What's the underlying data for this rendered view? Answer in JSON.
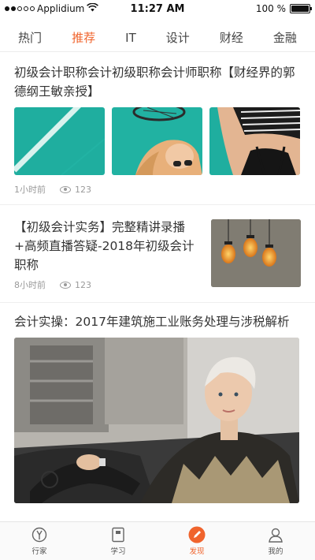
{
  "status_bar": {
    "carrier": "Applidium",
    "time": "11:27 AM",
    "battery": "100 %",
    "battery_level": 1.0
  },
  "tabs": [
    {
      "label": "热门",
      "active": false
    },
    {
      "label": "推荐",
      "active": true
    },
    {
      "label": "IT",
      "active": false
    },
    {
      "label": "设计",
      "active": false
    },
    {
      "label": "财经",
      "active": false
    },
    {
      "label": "金融",
      "active": false
    }
  ],
  "articles": [
    {
      "title": "初级会计职称会计初级职称会计师职称【财经界的郭德纲王敏亲授】",
      "time": "1小时前",
      "views": "123"
    },
    {
      "title": "【初级会计实务】完整精讲录播+高频直播答疑-2018年初级会计职称",
      "time": "8小时前",
      "views": "123"
    },
    {
      "title": "会计实操：2017年建筑施工业账务处理与涉税解析"
    }
  ],
  "bottom_nav": [
    {
      "label": "行家",
      "icon": "compass-icon",
      "active": false
    },
    {
      "label": "学习",
      "icon": "book-icon",
      "active": false
    },
    {
      "label": "发现",
      "icon": "pencil-icon",
      "active": true
    },
    {
      "label": "我的",
      "icon": "user-icon",
      "active": false
    }
  ],
  "colors": {
    "accent": "#f0642d",
    "text": "#333333",
    "meta": "#9a9a9a"
  }
}
